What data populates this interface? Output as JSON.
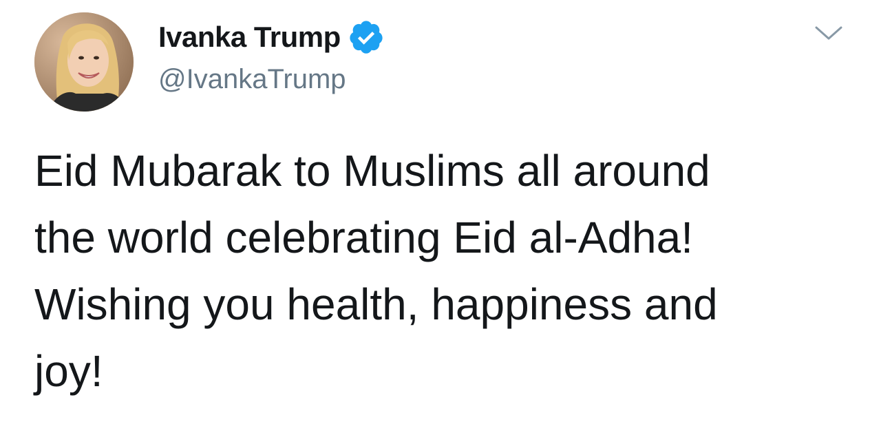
{
  "tweet": {
    "author": {
      "display_name": "Ivanka Trump",
      "handle": "@IvankaTrump",
      "verified": true,
      "avatar_icon": "profile-photo"
    },
    "text": "Eid Mubarak to Muslims all around\nthe world celebrating Eid al-Adha!\nWishing you health, happiness and\njoy!",
    "menu_icon": "chevron-down-icon"
  },
  "colors": {
    "text": "#14171a",
    "secondary_text": "#657786",
    "verified_blue": "#1da1f2",
    "chevron": "#8899a6"
  }
}
